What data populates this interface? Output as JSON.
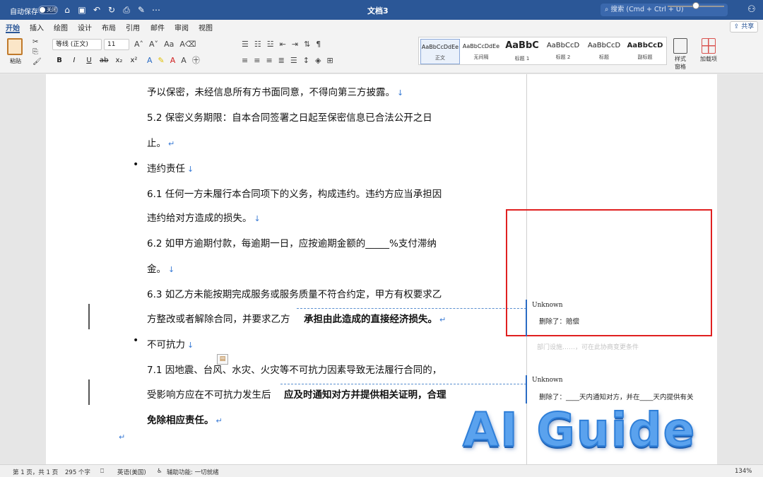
{
  "titlebar": {
    "autosave_label": "自动保存",
    "autosave_state": "关闭",
    "doc_title": "文档3",
    "search_placeholder": "搜索 (Cmd + Ctrl + U)",
    "icons": [
      "home-icon",
      "save-icon",
      "undo-icon",
      "redo-icon",
      "print-icon",
      "edit-icon",
      "more-icon"
    ]
  },
  "tabs": [
    {
      "label": "开始",
      "active": true
    },
    {
      "label": "插入"
    },
    {
      "label": "绘图"
    },
    {
      "label": "设计"
    },
    {
      "label": "布局"
    },
    {
      "label": "引用"
    },
    {
      "label": "邮件"
    },
    {
      "label": "审阅"
    },
    {
      "label": "视图"
    }
  ],
  "share_label": "共享",
  "ribbon": {
    "paste_label": "粘贴",
    "font_name": "等线 (正文)",
    "font_size": "11",
    "format_buttons": [
      "B",
      "I",
      "U",
      "ab",
      "x₂",
      "x²"
    ],
    "styles": [
      {
        "preview": "AaBbCcDdEe",
        "name": "正文"
      },
      {
        "preview": "AaBbCcDdEe",
        "name": "无间隔"
      },
      {
        "preview": "AaBbC",
        "name": "标题 1"
      },
      {
        "preview": "AaBbCcD",
        "name": "标题 2"
      },
      {
        "preview": "AaBbCcD",
        "name": "标题"
      },
      {
        "preview": "AaBbCcD",
        "name": "副标题"
      }
    ],
    "styles_pane_label": "样式\n窗格",
    "addins_label": "加载项"
  },
  "document": {
    "lines": [
      "予以保密，未经信息所有方书面同意，不得向第三方披露。",
      "5.2  保密义务期限：自本合同签署之日起至保密信息已合法公开之日",
      "止。",
      "违约责任",
      "6.1  任何一方未履行本合同项下的义务，构成违约。违约方应当承担因",
      "违约给对方造成的损失。",
      "6.2  如甲方逾期付款，每逾期一日，应按逾期金额的_____%支付滞纳",
      "金。",
      "6.3  如乙方未能按期完成服务或服务质量不符合约定，甲方有权要求乙",
      "方整改或者解除合同，并要求乙方",
      "承担由此造成的直接经济损失。",
      "不可抗力",
      "7.1  因地震、台风、水灾、火灾等不可抗力因素导致无法履行合同的，",
      "受影响方应在不可抗力发生后",
      "应及时通知对方并提供相关证明，合理",
      "免除相应责任。"
    ],
    "marks": {
      "down_arrow": "↓",
      "return": "↵"
    }
  },
  "comments": [
    {
      "author": "Unknown",
      "text": "删除了：赔偿"
    },
    {
      "author": "Unknown",
      "text": "删除了：____天内通知对方，并在____天内提供有关"
    }
  ],
  "faded_comment_text": "部门设施……，可在此协商变更条件",
  "watermark": "AI Guide",
  "statusbar": {
    "page": "第 1 页，共 1 页",
    "words": "295 个字",
    "language": "英语(美国)",
    "accessibility": "辅助功能: 一切就绪",
    "zoom": "134%"
  }
}
